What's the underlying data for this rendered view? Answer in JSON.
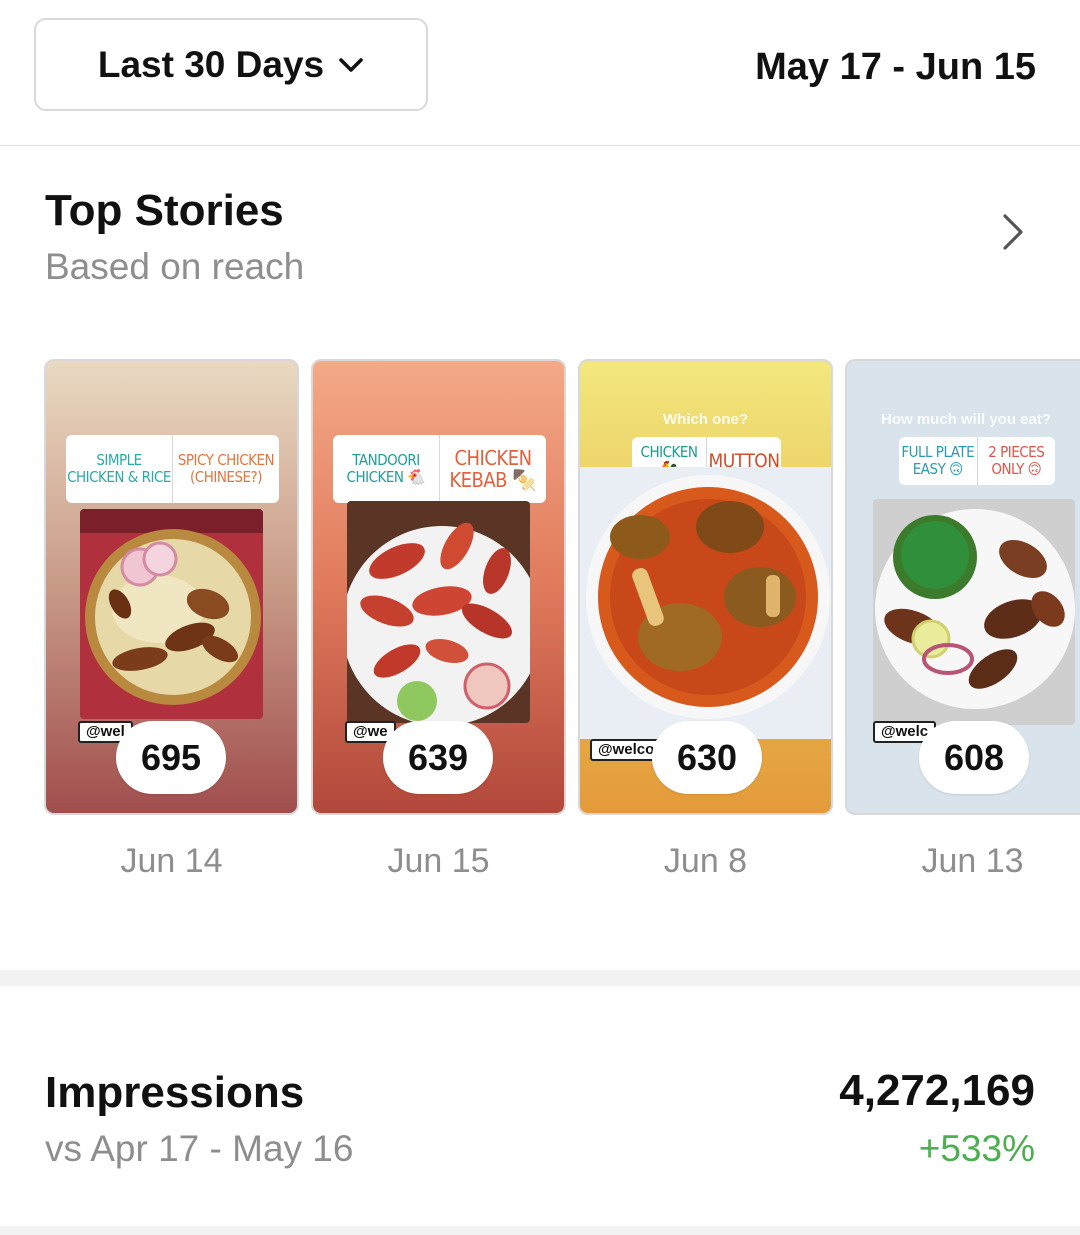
{
  "header": {
    "range_label": "Last 30 Days",
    "date_range": "May 17 - Jun 15"
  },
  "top_stories": {
    "title": "Top Stories",
    "subtitle": "Based on reach",
    "cards": [
      {
        "count": "695",
        "date": "Jun 14",
        "question": "",
        "poll": [
          "SIMPLE CHICKEN & RICE",
          "SPICY CHICKEN (CHINESE?)"
        ],
        "tag": "@wel"
      },
      {
        "count": "639",
        "date": "Jun 15",
        "question": "",
        "poll": [
          "TANDOORI CHICKEN 🐔",
          "CHICKEN KEBAB 🍢"
        ],
        "tag": "@we"
      },
      {
        "count": "630",
        "date": "Jun 8",
        "question": "Which one?",
        "poll": [
          "CHICKEN 🐓",
          "MUTTON"
        ],
        "tag": "@welcor"
      },
      {
        "count": "608",
        "date": "Jun 13",
        "question": "How much will you eat?",
        "poll": [
          "FULL PLATE EASY 🙃",
          "2 PIECES ONLY 🙃"
        ],
        "tag": "@welc"
      }
    ]
  },
  "impressions": {
    "title": "Impressions",
    "comparison": "vs Apr 17 - May 16",
    "value": "4,272,169",
    "change": "+533%"
  },
  "colors": {
    "muted_text": "#8e8e8e",
    "positive_change": "#4caf50"
  },
  "icons": [
    "chevron-down-icon",
    "chevron-right-icon"
  ]
}
